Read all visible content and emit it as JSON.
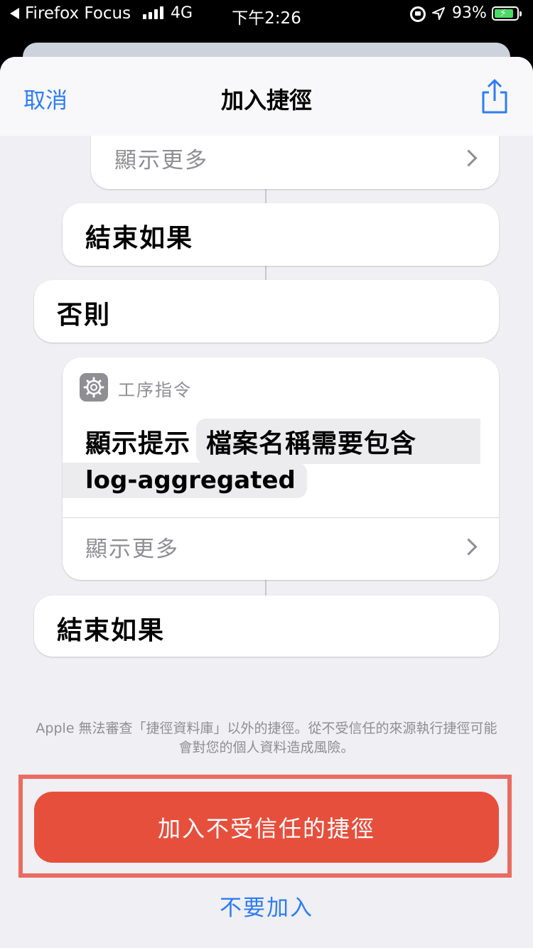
{
  "status_bar": {
    "back_app": "Firefox Focus",
    "network": "4G",
    "time": "下午2:26",
    "battery_percent": "93%",
    "battery_level": 0.93
  },
  "nav": {
    "cancel_label": "取消",
    "title": "加入捷徑",
    "share_icon": "share-icon"
  },
  "workflow": {
    "top_more_label": "顯示更多",
    "end_if_label_1": "結束如果",
    "otherwise_label": "否則",
    "alert_action": {
      "app_name": "工序指令",
      "action_label": "顯示提示",
      "token_text_line1": "檔案名稱需要包含",
      "token_text_line2": "log-aggregated",
      "more_label": "顯示更多"
    },
    "end_if_label_2": "結束如果"
  },
  "notice": "Apple 無法審查「捷徑資料庫」以外的捷徑。從不受信任的來源執行捷徑可能會對您的個人資料造成風險。",
  "actions": {
    "add_untrusted_label": "加入不受信任的捷徑",
    "dont_add_label": "不要加入"
  },
  "colors": {
    "accent_blue": "#2f7cf6",
    "danger_red": "#e74f3d",
    "highlight_border": "#ea6b60"
  }
}
